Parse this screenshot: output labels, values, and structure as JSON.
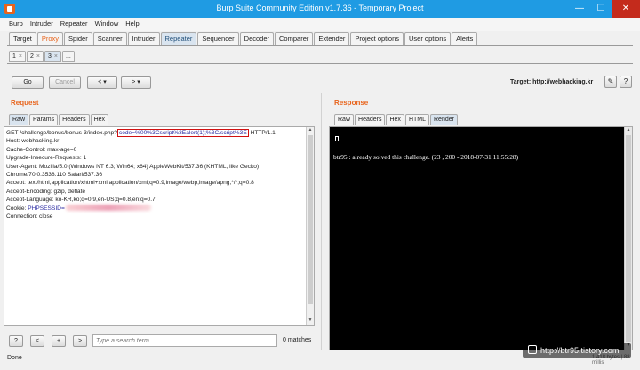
{
  "window": {
    "title": "Burp Suite Community Edition v1.7.36 - Temporary Project",
    "min_glyph": "—",
    "max_glyph": "☐",
    "close_glyph": "✕"
  },
  "menu": [
    "Burp",
    "Intruder",
    "Repeater",
    "Window",
    "Help"
  ],
  "tool_tabs": [
    "Target",
    "Proxy",
    "Spider",
    "Scanner",
    "Intruder",
    "Repeater",
    "Sequencer",
    "Decoder",
    "Comparer",
    "Extender",
    "Project options",
    "User options",
    "Alerts"
  ],
  "repeater_tabs": [
    {
      "label": "1",
      "close": "×"
    },
    {
      "label": "2",
      "close": "×"
    },
    {
      "label": "3",
      "close": "×"
    },
    {
      "label": "...",
      "close": ""
    }
  ],
  "toolbar": {
    "go": "Go",
    "cancel": "Cancel",
    "back": "<",
    "back_menu": "▾",
    "forward": ">",
    "forward_menu": "▾",
    "target_label": "Target: http://webhacking.kr",
    "edit_icon": "✎",
    "help_icon": "?"
  },
  "request": {
    "title": "Request",
    "tabs": [
      "Raw",
      "Params",
      "Headers",
      "Hex"
    ],
    "line1_pre": "GET /challenge/bonus/bonus-3/index.php?",
    "line1_highlight": "code=%00%3Cscript%3Ealert(1);%3C/script%3E",
    "line1_post": " HTTP/1.1",
    "lines": [
      "Host: webhacking.kr",
      "Cache-Control: max-age=0",
      "Upgrade-Insecure-Requests: 1",
      "User-Agent: Mozilla/5.0 (Windows NT 6.3; Win64; x64) AppleWebKit/537.36 (KHTML, like Gecko)",
      "Chrome/70.0.3538.110 Safari/537.36",
      "Accept: text/html,application/xhtml+xml,application/xml;q=0.9,image/webp,image/apng,*/*;q=0.8",
      "Accept-Encoding: gzip, deflate",
      "Accept-Language: ko-KR,ko;q=0.9,en-US;q=0.8,en;q=0.7"
    ],
    "cookie_label": "Cookie: ",
    "cookie_value": "PHPSESSID=",
    "last_line": "Connection: close"
  },
  "response": {
    "title": "Response",
    "tabs": [
      "Raw",
      "Headers",
      "Hex",
      "HTML",
      "Render"
    ],
    "render_text": "btr95 : already solved this challenge. (23 , 200 - 2018-07-31 11:55:28)"
  },
  "search": {
    "help": "?",
    "prev": "<",
    "next": "+",
    "forward": ">",
    "placeholder": "Type a search term",
    "matches": "0 matches"
  },
  "status": {
    "text": "Done",
    "right": "1,418 bytes | 88 millis"
  },
  "watermark": "http://btr95.tistory.com"
}
